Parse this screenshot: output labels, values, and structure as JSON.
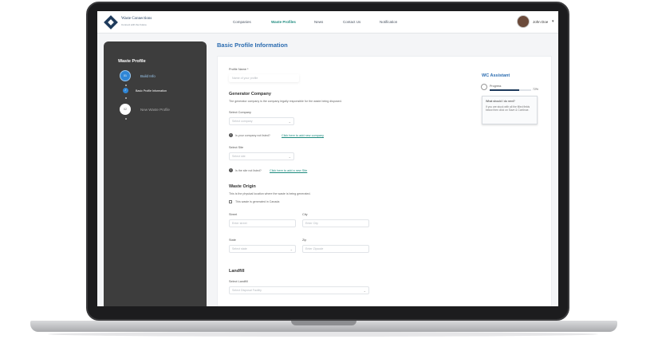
{
  "header": {
    "brand": "Waste Connections",
    "brand_sub": "Connect with the Future",
    "nav": [
      "Companies",
      "Waste Profiles",
      "News",
      "Contact Us",
      "Notification"
    ],
    "active_nav": "Waste Profiles",
    "user_name": "John Doe",
    "colors": {
      "accent": "#1c8a7e",
      "title": "#2b6cb0"
    }
  },
  "sidebar": {
    "title": "Waste Profile",
    "steps": [
      {
        "number": "01",
        "label": "Build Info"
      },
      {
        "number": "",
        "label": "Basic Profile Information"
      },
      {
        "number": "02",
        "label": "New Waste Profile"
      }
    ]
  },
  "main": {
    "title": "Basic Profile Information",
    "profile_name": {
      "label": "Profile Name *",
      "placeholder": "Name of your profile"
    },
    "generator": {
      "heading": "Generator Company",
      "desc": "The generator company is the company legally responsible for the waste being disposed.",
      "select_label": "Select Company",
      "select_value": "Select company",
      "not_listed": "Is your company not listed?",
      "add_link": "Click here to add new company"
    },
    "site": {
      "label": "Select Site",
      "value": "Select site",
      "not_listed": "Is the site not listed?",
      "add_link": "Click here to add a new Site"
    },
    "origin": {
      "heading": "Waste Origin",
      "desc": "This is the physical location where the waste is being generated.",
      "checkbox": "This waste is generated in Canada",
      "street_label": "Street",
      "street_placeholder": "Enter street",
      "city_label": "City",
      "city_placeholder": "Enter City",
      "state_label": "State",
      "state_value": "Select state",
      "zip_label": "Zip",
      "zip_placeholder": "Enter Zipcode"
    },
    "landfill": {
      "heading": "Landfill",
      "label": "Select Landfill",
      "value": "Select Disposal Facility"
    }
  },
  "assistant": {
    "title": "WC Assistant",
    "progress_label": "Progress",
    "progress": 0.72,
    "progress_text": "72%",
    "tip_question": "What should I do next?",
    "tip_answer": "If you are stuck with all the filled fields below then click on Save & Continue."
  }
}
